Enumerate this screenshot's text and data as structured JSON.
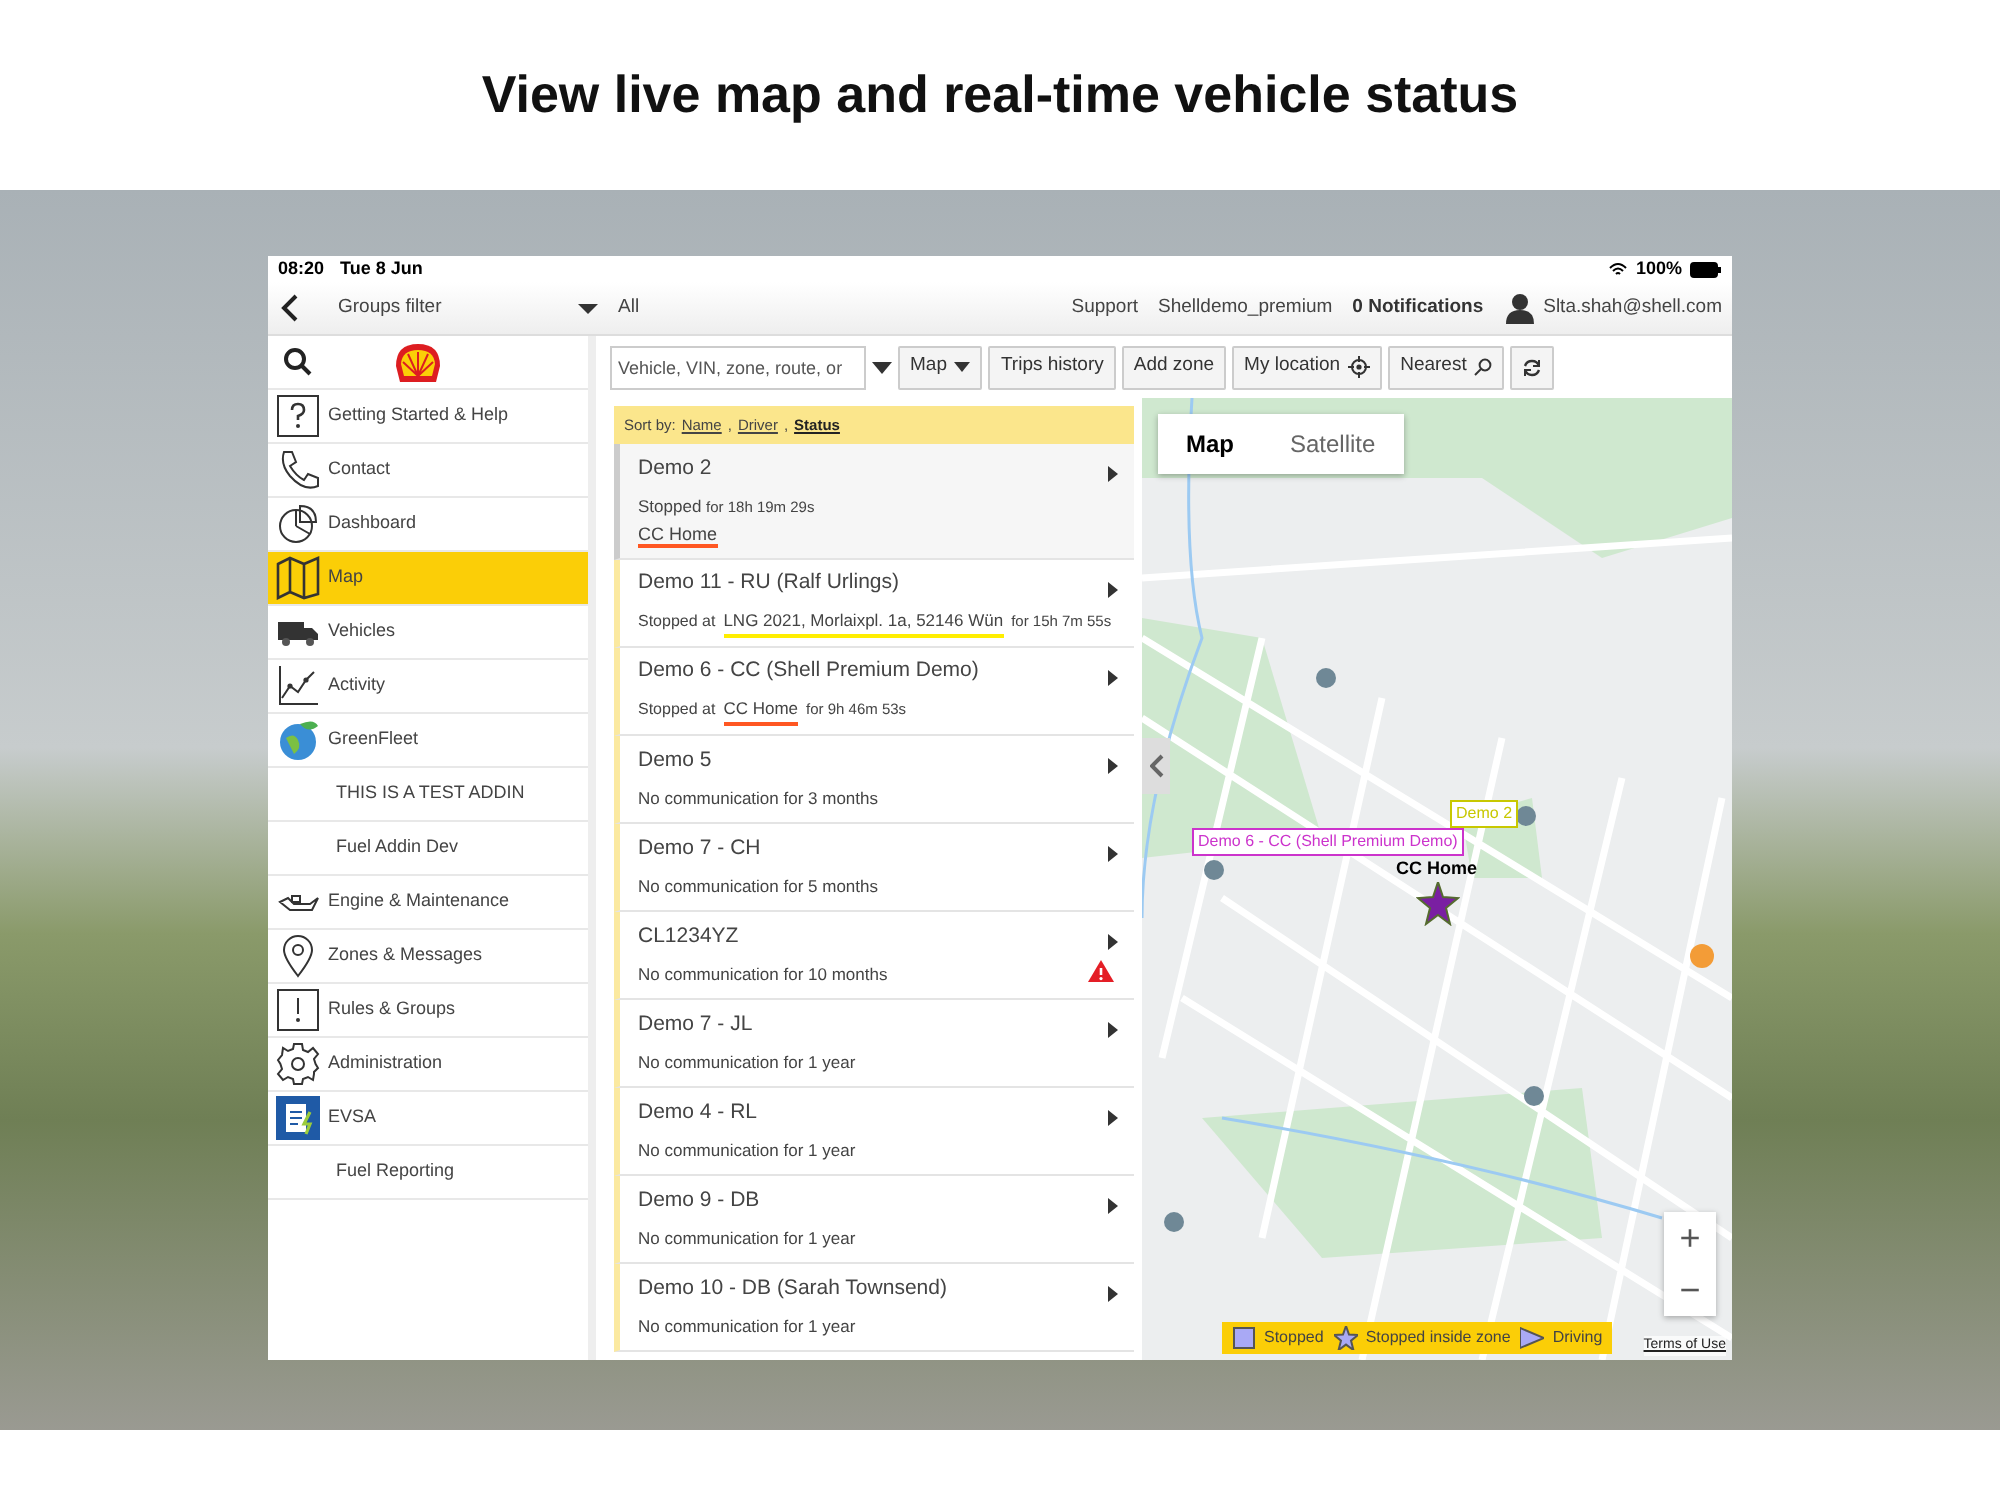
{
  "headline": "View live map and real-time vehicle status",
  "status_bar": {
    "time": "08:20",
    "date": "Tue 8 Jun",
    "battery": "100%"
  },
  "top_bar": {
    "groups_filter": "Groups filter",
    "groups_value": "All",
    "links": [
      "Support",
      "Shelldemo_premium"
    ],
    "notifications": "0 Notifications",
    "user": "Slta.shah@shell.com"
  },
  "toolbar": {
    "search": {
      "placeholder": "Vehicle, VIN, zone, route, or"
    },
    "buttons": [
      {
        "label": "Map",
        "kind": "dropdown"
      },
      {
        "label": "Trips history",
        "kind": "plain"
      },
      {
        "label": "Add zone",
        "kind": "plain"
      },
      {
        "label": "My location",
        "kind": "locate"
      },
      {
        "label": "Nearest",
        "kind": "search"
      },
      {
        "kind": "refresh"
      }
    ]
  },
  "sidebar": {
    "items": [
      {
        "label": "Getting Started & Help",
        "kind": "help",
        "selected": false
      },
      {
        "label": "Contact",
        "kind": "phone",
        "selected": false
      },
      {
        "label": "Dashboard",
        "kind": "pie",
        "selected": false
      },
      {
        "label": "Map",
        "kind": "map",
        "selected": true
      },
      {
        "label": "Vehicles",
        "kind": "truck",
        "selected": false
      },
      {
        "label": "Activity",
        "kind": "chart",
        "selected": false
      },
      {
        "label": "GreenFleet",
        "kind": "globe",
        "selected": false
      },
      {
        "label": "THIS IS A TEST ADDIN",
        "kind": "none",
        "selected": false
      },
      {
        "label": "Fuel Addin Dev",
        "kind": "none",
        "selected": false
      },
      {
        "label": "Engine & Maintenance",
        "kind": "oil",
        "selected": false
      },
      {
        "label": "Zones & Messages",
        "kind": "pin",
        "selected": false
      },
      {
        "label": "Rules & Groups",
        "kind": "alert",
        "selected": false
      },
      {
        "label": "Administration",
        "kind": "gear",
        "selected": false
      },
      {
        "label": "EVSA",
        "kind": "clipboard",
        "selected": false
      },
      {
        "label": "Fuel Reporting",
        "kind": "none",
        "selected": false
      }
    ]
  },
  "sort": {
    "label": "Sort by:",
    "separator": ",",
    "options": [
      {
        "label": "Name",
        "selected": false
      },
      {
        "label": "Driver",
        "selected": false
      },
      {
        "label": "Status",
        "selected": true
      }
    ]
  },
  "vehicles": [
    {
      "name": "Demo 2",
      "kind": "stopped-zone",
      "status": "Stopped",
      "duration": "for 18h 19m 29s",
      "location": "CC Home",
      "color": "#ff5722",
      "selected": true,
      "warning": false
    },
    {
      "name": "Demo 11 - RU (Ralf Urlings)",
      "kind": "stopped-at",
      "status": "Stopped at",
      "location": "LNG 2021, Morlaixpl. 1a, 52146 Wün",
      "duration": "for 15h 7m 55s",
      "color": "#ffee00",
      "selected": false,
      "warning": false
    },
    {
      "name": "Demo 6 - CC (Shell Premium Demo)",
      "kind": "stopped-at",
      "status": "Stopped at",
      "location": "CC Home",
      "duration": "for 9h 46m 53s",
      "color": "#ff5722",
      "selected": false,
      "warning": false
    },
    {
      "name": "Demo 5",
      "kind": "offline",
      "status": "No communication for 3 months",
      "selected": false,
      "warning": false
    },
    {
      "name": "Demo 7 - CH",
      "kind": "offline",
      "status": "No communication for 5 months",
      "selected": false,
      "warning": false
    },
    {
      "name": "CL1234YZ",
      "kind": "offline",
      "status": "No communication for 10 months",
      "selected": false,
      "warning": true
    },
    {
      "name": "Demo 7 - JL",
      "kind": "offline",
      "status": "No communication for 1 year",
      "selected": false,
      "warning": false
    },
    {
      "name": "Demo 4 - RL",
      "kind": "offline",
      "status": "No communication for 1 year",
      "selected": false,
      "warning": false
    },
    {
      "name": "Demo 9 - DB",
      "kind": "offline",
      "status": "No communication for 1 year",
      "selected": false,
      "warning": false
    },
    {
      "name": "Demo 10 - DB (Sarah Townsend)",
      "kind": "offline",
      "status": "No communication for 1 year",
      "selected": false,
      "warning": false
    }
  ],
  "map": {
    "type_tabs": [
      {
        "label": "Map",
        "selected": true
      },
      {
        "label": "Satellite",
        "selected": false
      }
    ],
    "markers": [
      {
        "label": "Demo 2",
        "color": "#c8c800"
      },
      {
        "label": "Demo 6 - CC (Shell Premium Demo)",
        "color": "#cc33cc"
      }
    ],
    "zone_label": "CC Home",
    "zoom_buttons": [
      "+",
      "−"
    ],
    "legend": [
      {
        "label": "Stopped",
        "kind": "square"
      },
      {
        "label": "Stopped inside zone",
        "kind": "star"
      },
      {
        "label": "Driving",
        "kind": "triangle"
      }
    ],
    "terms": "Terms of Use"
  }
}
